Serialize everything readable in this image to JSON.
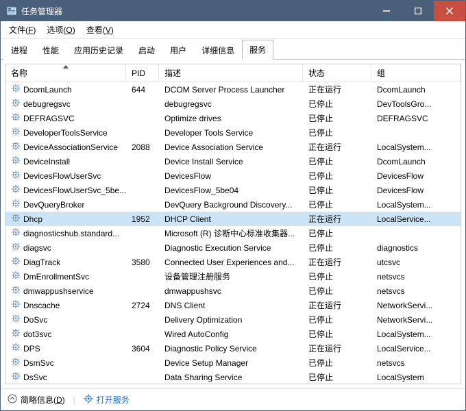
{
  "window": {
    "title": "任务管理器"
  },
  "menus": {
    "file": "文件(<u>F</u>)",
    "options": "选项(<u>O</u>)",
    "view": "查看(<u>V</u>)"
  },
  "tabs": {
    "processes": "进程",
    "performance": "性能",
    "history": "应用历史记录",
    "startup": "启动",
    "users": "用户",
    "details": "详细信息",
    "services": "服务",
    "active": "services"
  },
  "columns": {
    "name": "名称",
    "pid": "PID",
    "desc": "描述",
    "status": "状态",
    "group": "组"
  },
  "sort_col": "name",
  "selected_index": 9,
  "rows": [
    {
      "name": "DcomLaunch",
      "pid": "644",
      "desc": "DCOM Server Process Launcher",
      "status": "正在运行",
      "group": "DcomLaunch"
    },
    {
      "name": "debugregsvc",
      "pid": "",
      "desc": "debugregsvc",
      "status": "已停止",
      "group": "DevToolsGro..."
    },
    {
      "name": "DEFRAGSVC",
      "pid": "",
      "desc": "Optimize drives",
      "status": "已停止",
      "group": "DEFRAGSVC"
    },
    {
      "name": "DeveloperToolsService",
      "pid": "",
      "desc": "Developer Tools Service",
      "status": "已停止",
      "group": ""
    },
    {
      "name": "DeviceAssociationService",
      "pid": "2088",
      "desc": "Device Association Service",
      "status": "正在运行",
      "group": "LocalSystem..."
    },
    {
      "name": "DeviceInstall",
      "pid": "",
      "desc": "Device Install Service",
      "status": "已停止",
      "group": "DcomLaunch"
    },
    {
      "name": "DevicesFlowUserSvc",
      "pid": "",
      "desc": "DevicesFlow",
      "status": "已停止",
      "group": "DevicesFlow"
    },
    {
      "name": "DevicesFlowUserSvc_5be...",
      "pid": "",
      "desc": "DevicesFlow_5be04",
      "status": "已停止",
      "group": "DevicesFlow"
    },
    {
      "name": "DevQueryBroker",
      "pid": "",
      "desc": "DevQuery Background Discovery...",
      "status": "已停止",
      "group": "LocalSystem..."
    },
    {
      "name": "Dhcp",
      "pid": "1952",
      "desc": "DHCP Client",
      "status": "正在运行",
      "group": "LocalService..."
    },
    {
      "name": "diagnosticshub.standard...",
      "pid": "",
      "desc": "Microsoft (R) 诊断中心标准收集器...",
      "status": "已停止",
      "group": ""
    },
    {
      "name": "diagsvc",
      "pid": "",
      "desc": "Diagnostic Execution Service",
      "status": "已停止",
      "group": "diagnostics"
    },
    {
      "name": "DiagTrack",
      "pid": "3580",
      "desc": "Connected User Experiences and...",
      "status": "正在运行",
      "group": "utcsvc"
    },
    {
      "name": "DmEnrollmentSvc",
      "pid": "",
      "desc": "设备管理注册服务",
      "status": "已停止",
      "group": "netsvcs"
    },
    {
      "name": "dmwappushservice",
      "pid": "",
      "desc": "dmwappushsvc",
      "status": "已停止",
      "group": "netsvcs"
    },
    {
      "name": "Dnscache",
      "pid": "2724",
      "desc": "DNS Client",
      "status": "正在运行",
      "group": "NetworkServi..."
    },
    {
      "name": "DoSvc",
      "pid": "",
      "desc": "Delivery Optimization",
      "status": "已停止",
      "group": "NetworkServi..."
    },
    {
      "name": "dot3svc",
      "pid": "",
      "desc": "Wired AutoConfig",
      "status": "已停止",
      "group": "LocalSystem..."
    },
    {
      "name": "DPS",
      "pid": "3604",
      "desc": "Diagnostic Policy Service",
      "status": "正在运行",
      "group": "LocalService..."
    },
    {
      "name": "DsmSvc",
      "pid": "",
      "desc": "Device Setup Manager",
      "status": "已停止",
      "group": "netsvcs"
    },
    {
      "name": "DsSvc",
      "pid": "",
      "desc": "Data Sharing Service",
      "status": "已停止",
      "group": "LocalSystem"
    }
  ],
  "statusbar": {
    "fewer": "简略信息(<u>D</u>)",
    "open_services": "打开服务"
  }
}
